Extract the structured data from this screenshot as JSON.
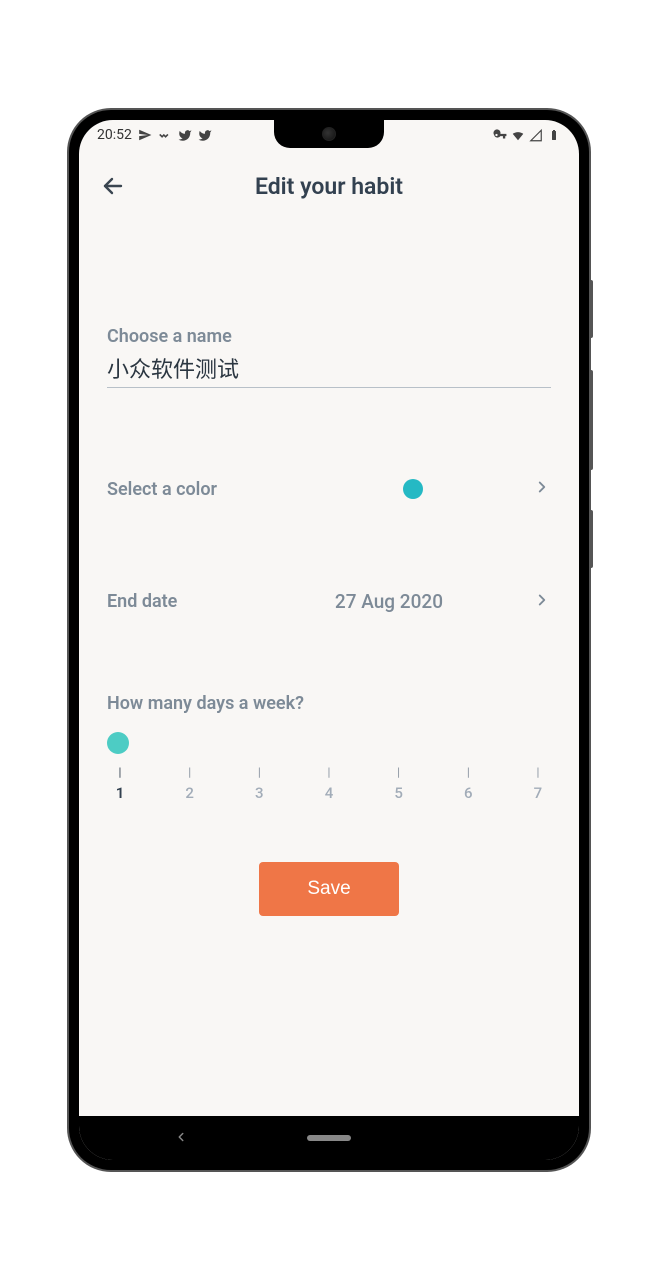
{
  "status": {
    "time": "20:52",
    "left_icons": [
      "send-icon",
      "badge-icon",
      "bird-icon",
      "bird-icon"
    ],
    "right_icons": [
      "vpn-key-icon",
      "wifi-icon",
      "signal-empty-icon",
      "battery-icon"
    ]
  },
  "header": {
    "title": "Edit your habit"
  },
  "form": {
    "name_label": "Choose a name",
    "name_value": "小众软件测试",
    "color_label": "Select a color",
    "selected_color": "#25b9c4",
    "end_date_label": "End date",
    "end_date_value": "27 Aug 2020",
    "days_label": "How many days a week?",
    "days_value": 1,
    "days_ticks": [
      "1",
      "2",
      "3",
      "4",
      "5",
      "6",
      "7"
    ],
    "save_label": "Save"
  }
}
